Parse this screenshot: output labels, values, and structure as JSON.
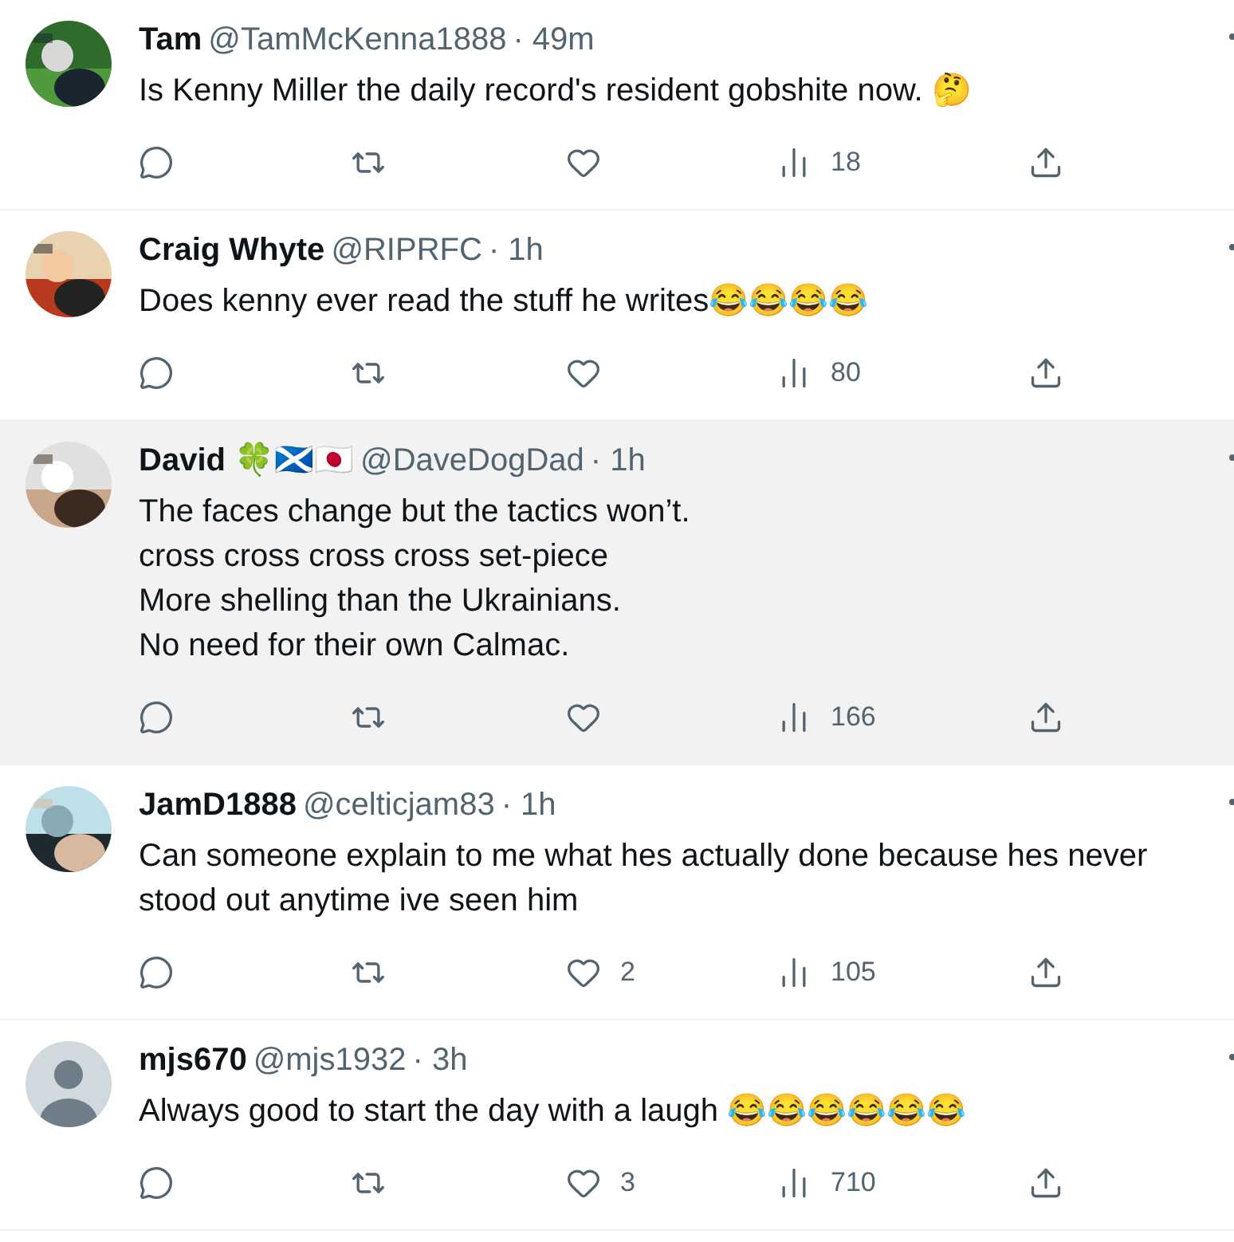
{
  "tweets": [
    {
      "name": "Tam",
      "handle": "@TamMcKenna1888",
      "time": "· 49m",
      "lines": [
        "Is Kenny Miller the daily record's resident gobshite now. 🤔"
      ],
      "views": "18",
      "highlighted": false,
      "avatar": {
        "kind": "picture"
      }
    },
    {
      "name": "Craig Whyte",
      "handle": "@RIPRFC",
      "time": "· 1h",
      "lines": [
        "Does kenny ever read the stuff he writes😂😂😂😂"
      ],
      "views": "80",
      "highlighted": false,
      "avatar": {
        "kind": "picture"
      }
    },
    {
      "name": "David 🍀🏴󠁧󠁢󠁳󠁣󠁴󠁿🇯🇵",
      "handle": "@DaveDogDad",
      "time": "· 1h",
      "lines": [
        "The faces change but the tactics won’t.",
        "cross cross cross cross set-piece",
        "More shelling than the Ukrainians.",
        "No need for their own Calmac."
      ],
      "views": "166",
      "highlighted": true,
      "avatar": {
        "kind": "picture"
      }
    },
    {
      "name": "JamD1888",
      "handle": "@celticjam83",
      "time": "· 1h",
      "lines": [
        "Can someone explain to me what hes actually done because hes never stood out anytime ive seen him"
      ],
      "likes": "2",
      "views": "105",
      "highlighted": false,
      "avatar": {
        "kind": "picture"
      }
    },
    {
      "name": "mjs670",
      "handle": "@mjs1932",
      "time": "· 3h",
      "lines": [
        "Always good to start the day with a laugh  😂😂😂😂😂😂"
      ],
      "likes": "3",
      "views": "710",
      "highlighted": false,
      "avatar": {
        "kind": "default"
      }
    }
  ]
}
